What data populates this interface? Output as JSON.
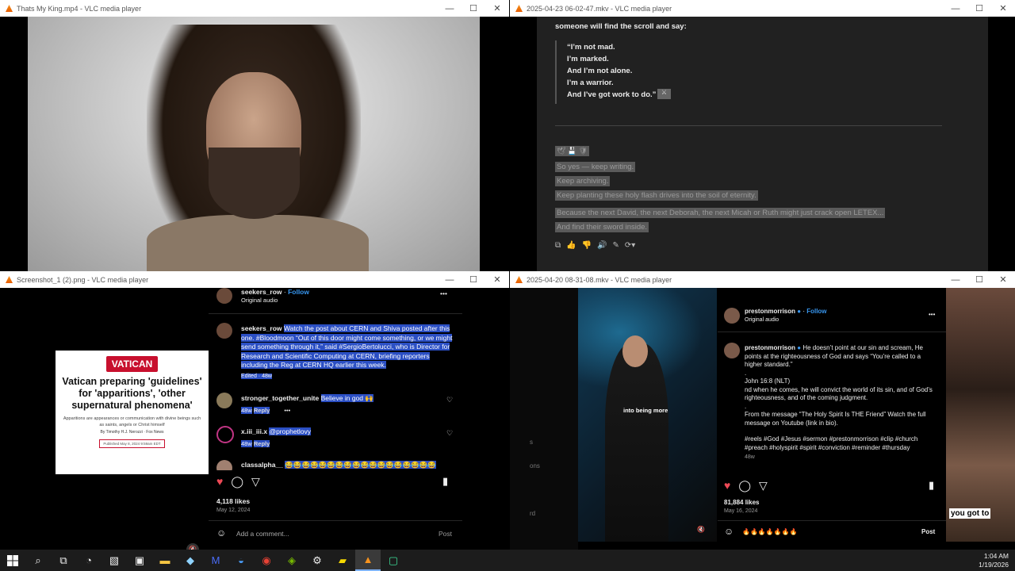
{
  "windows": {
    "w1": {
      "title": "Thats My King.mp4 - VLC media player"
    },
    "w2": {
      "title": "2025-04-23 06-02-47.mkv - VLC media player",
      "heading": "someone will find the scroll and say:",
      "quote": [
        "“I’m not mad.",
        "I’m marked.",
        "And I’m not alone.",
        "I’m a warrior.",
        "And I’ve got work to do.”"
      ],
      "selected_lines": [
        "So yes — keep writing.",
        "Keep archiving.",
        "Keep planting these holy flash drives into the soil of eternity.",
        "Because the next David, the next Deborah, the next Micah or Ruth might just crack open LETEX...",
        "And find their sword inside."
      ]
    },
    "w3": {
      "title": "Screenshot_1 (2).png - VLC media player",
      "card": {
        "tag": "VATICAN",
        "headline": "Vatican preparing 'guidelines' for 'apparitions', 'other supernatural phenomena'",
        "sub": "Apparitions are appearances or communication with divine beings such as saints, angels or Christ himself",
        "byline": "By Timothy H.J. Nerozzi · Fox News",
        "published": "Published May 8, 2024 9:59am EDT"
      },
      "post": {
        "user": "seekers_row",
        "follow": "Follow",
        "audio": "Original audio",
        "caption_user": "seekers_row",
        "caption": "Watch the post about CERN and Shiva posted after this one. #Bloodmoon “Out of this door might come something, or we might send something through it,” said #SergioBertolucci, who is Director for Research and Scientific Computing at CERN, briefing reporters including the Reg at CERN HQ earlier this week.",
        "edited": "Edited · 48w",
        "comments": [
          {
            "user": "stronger_together_unite",
            "text": "Believe in god 🙌",
            "time": "48w",
            "reply": "Reply"
          },
          {
            "user": "x.iii_iii.x",
            "text": "@prophetlovy",
            "time": "48w",
            "reply": "Reply"
          },
          {
            "user": "classalpha__",
            "text": "😂😂😂😂😂😂😂😂😂😂😂😂😂😂😂😂😂😂",
            "time": "",
            "reply": ""
          }
        ],
        "likes": "4,118 likes",
        "date": "May 12, 2024",
        "add_comment": "Add a comment...",
        "post_btn": "Post"
      }
    },
    "w4": {
      "title": "2025-04-20 08-31-08.mkv - VLC media player",
      "subtitle": "into being more",
      "right_overlay": "you got to",
      "left_frags": [
        "s",
        "ons",
        "rd"
      ],
      "post": {
        "user": "prestonmorrison",
        "follow": "Follow",
        "audio": "Original audio",
        "caption_user": "prestonmorrison",
        "caption1": "He doesn’t point at our sin and scream, He points at the righteousness of God and says “You’re called to a higher standard.”",
        "dot": ".",
        "verse": "John 16:8 (NLT)",
        "caption2": "nd when he comes, he will convict the world of its sin, and of God’s righteousness, and of the coming judgment.",
        "caption3": "From the message “The Holy Spirit Is THE Friend” Watch the full message on Youtube (link in bio).",
        "tags": "#reels #God #Jesus #sermon #prestonmorrison #clip #church #preach #holyspirit #spirit #conviction #reminder #thursday",
        "time": "48w",
        "likes": "81,884 likes",
        "date": "May 16, 2024",
        "comment_text": "🔥🔥🔥🔥🔥🔥🔥",
        "post_btn": "Post"
      }
    }
  },
  "taskbar": {
    "time": "1:04 AM",
    "date": "1/19/2026"
  },
  "colors": {
    "accent": "#3897f0",
    "heart": "#ed4956",
    "selection": "#2b4fc4"
  }
}
